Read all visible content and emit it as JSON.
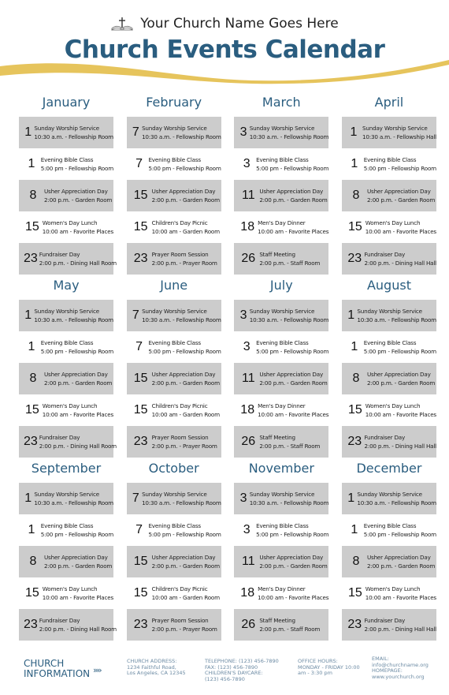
{
  "header": {
    "church_name": "Your Church Name Goes Here",
    "title": "Church Events Calendar",
    "icon": "bible-cross-icon",
    "accent_color": "#2a5d7f",
    "swoosh_color": "#e6c45c"
  },
  "months": [
    {
      "name": "January",
      "events": [
        {
          "day": "1",
          "title": "Sunday Worship Service",
          "detail": "10:30 a.m. - Fellowship Room"
        },
        {
          "day": "1",
          "title": "Evening Bible Class",
          "detail": "5:00 pm - Fellowship Room"
        },
        {
          "day": "8",
          "title": "Usher Appreciation Day",
          "detail": "2:00 p.m. - Garden Room"
        },
        {
          "day": "15",
          "title": "Women's Day Lunch",
          "detail": "10:00 am - Favorite Places"
        },
        {
          "day": "23",
          "title": "Fundraiser Day",
          "detail": "2:00 p.m. - Dining Hall Room"
        }
      ]
    },
    {
      "name": "February",
      "events": [
        {
          "day": "7",
          "title": "Sunday Worship Service",
          "detail": "10:30 a.m. - Fellowship Room"
        },
        {
          "day": "7",
          "title": "Evening Bible Class",
          "detail": "5:00 pm - Fellowship Room"
        },
        {
          "day": "15",
          "title": "Usher Appreciation Day",
          "detail": "2:00 p.m. - Garden Room"
        },
        {
          "day": "15",
          "title": "Children's Day Picnic",
          "detail": "10:00 am - Garden Room"
        },
        {
          "day": "23",
          "title": "Prayer Room Session",
          "detail": "2:00 p.m. - Prayer Room"
        }
      ]
    },
    {
      "name": "March",
      "events": [
        {
          "day": "3",
          "title": "Sunday Worship Service",
          "detail": "10:30 a.m. - Fellowship Room"
        },
        {
          "day": "3",
          "title": "Evening Bible Class",
          "detail": "5:00 pm - Fellowship Room"
        },
        {
          "day": "11",
          "title": "Usher Appreciation Day",
          "detail": "2:00 p.m. - Garden Room"
        },
        {
          "day": "18",
          "title": "Men's Day Dinner",
          "detail": "10:00 am - Favorite Places"
        },
        {
          "day": "26",
          "title": "Staff Meeting",
          "detail": "2:00 p.m. - Staff Room"
        }
      ]
    },
    {
      "name": "April",
      "events": [
        {
          "day": "1",
          "title": "Sunday Worship Service",
          "detail": "10:30 a.m. - Fellowship Hall"
        },
        {
          "day": "1",
          "title": "Evening Bible Class",
          "detail": "5:00 pm - Fellowship Room"
        },
        {
          "day": "8",
          "title": "Usher Appreciation Day",
          "detail": "2:00 p.m. - Garden Room"
        },
        {
          "day": "15",
          "title": "Women's Day Lunch",
          "detail": "10:00 am - Favorite Places"
        },
        {
          "day": "23",
          "title": "Fundraiser Day",
          "detail": "2:00 p.m. - Dining Hall Hall"
        }
      ]
    },
    {
      "name": "May",
      "events": [
        {
          "day": "1",
          "title": "Sunday Worship Service",
          "detail": "10:30 a.m. - Fellowship Room"
        },
        {
          "day": "1",
          "title": "Evening Bible Class",
          "detail": "5:00 pm - Fellowship Room"
        },
        {
          "day": "8",
          "title": "Usher Appreciation Day",
          "detail": "2:00 p.m. - Garden Room"
        },
        {
          "day": "15",
          "title": "Women's Day Lunch",
          "detail": "10:00 am - Favorite Places"
        },
        {
          "day": "23",
          "title": "Fundraiser Day",
          "detail": "2:00 p.m. - Dining Hall Room"
        }
      ]
    },
    {
      "name": "June",
      "events": [
        {
          "day": "7",
          "title": "Sunday Worship Service",
          "detail": "10:30 a.m. - Fellowship Room"
        },
        {
          "day": "7",
          "title": "Evening Bible Class",
          "detail": "5:00 pm - Fellowship Room"
        },
        {
          "day": "15",
          "title": "Usher Appreciation Day",
          "detail": "2:00 p.m. - Garden Room"
        },
        {
          "day": "15",
          "title": "Children's Day Picnic",
          "detail": "10:00 am - Garden Room"
        },
        {
          "day": "23",
          "title": "Prayer Room Session",
          "detail": "2:00 p.m. - Prayer Room"
        }
      ]
    },
    {
      "name": "July",
      "events": [
        {
          "day": "3",
          "title": "Sunday Worship Service",
          "detail": "10:30 a.m. - Fellowship Room"
        },
        {
          "day": "3",
          "title": "Evening Bible Class",
          "detail": "5:00 pm - Fellowship Room"
        },
        {
          "day": "11",
          "title": "Usher Appreciation Day",
          "detail": "2:00 p.m. - Garden Room"
        },
        {
          "day": "18",
          "title": "Men's Day Dinner",
          "detail": "10:00 am - Favorite Places"
        },
        {
          "day": "26",
          "title": "Staff Meeting",
          "detail": "2:00 p.m. - Staff Room"
        }
      ]
    },
    {
      "name": "August",
      "events": [
        {
          "day": "1",
          "title": "Sunday Worship Service",
          "detail": "10:30 a.m. - Fellowship Room"
        },
        {
          "day": "1",
          "title": "Evening Bible Class",
          "detail": "5:00 pm - Fellowship Room"
        },
        {
          "day": "8",
          "title": "Usher Appreciation Day",
          "detail": "2:00 p.m. - Garden Room"
        },
        {
          "day": "15",
          "title": "Women's Day Lunch",
          "detail": "10:00 am - Favorite Places"
        },
        {
          "day": "23",
          "title": "Fundraiser Day",
          "detail": "2:00 p.m. - Dining Hall Hall"
        }
      ]
    },
    {
      "name": "September",
      "events": [
        {
          "day": "1",
          "title": "Sunday Worship Service",
          "detail": "10:30 a.m. - Fellowship Room"
        },
        {
          "day": "1",
          "title": "Evening Bible Class",
          "detail": "5:00 pm - Fellowship Room"
        },
        {
          "day": "8",
          "title": "Usher Appreciation Day",
          "detail": "2:00 p.m. - Garden Room"
        },
        {
          "day": "15",
          "title": "Women's Day Lunch",
          "detail": "10:00 am - Favorite Places"
        },
        {
          "day": "23",
          "title": "Fundraiser Day",
          "detail": "2:00 p.m. - Dining Hall Room"
        }
      ]
    },
    {
      "name": "October",
      "events": [
        {
          "day": "7",
          "title": "Sunday Worship Service",
          "detail": "10:30 a.m. - Fellowship Room"
        },
        {
          "day": "7",
          "title": "Evening Bible Class",
          "detail": "5:00 pm - Fellowship Room"
        },
        {
          "day": "15",
          "title": "Usher Appreciation Day",
          "detail": "2:00 p.m. - Garden Room"
        },
        {
          "day": "15",
          "title": "Children's Day Picnic",
          "detail": "10:00 am - Garden Room"
        },
        {
          "day": "23",
          "title": "Prayer Room Session",
          "detail": "2:00 p.m. - Prayer Room"
        }
      ]
    },
    {
      "name": "November",
      "events": [
        {
          "day": "3",
          "title": "Sunday Worship Service",
          "detail": "10:30 a.m. - Fellowship Room"
        },
        {
          "day": "3",
          "title": "Evening Bible Class",
          "detail": "5:00 pm - Fellowship Room"
        },
        {
          "day": "11",
          "title": "Usher Appreciation Day",
          "detail": "2:00 p.m. - Garden Room"
        },
        {
          "day": "18",
          "title": "Men's Day Dinner",
          "detail": "10:00 am - Favorite Places"
        },
        {
          "day": "26",
          "title": "Staff Meeting",
          "detail": "2:00 p.m. - Staff Room"
        }
      ]
    },
    {
      "name": "December",
      "events": [
        {
          "day": "1",
          "title": "Sunday Worship Service",
          "detail": "10:30 a.m. - Fellowship Room"
        },
        {
          "day": "1",
          "title": "Evening Bible Class",
          "detail": "5:00 pm - Fellowship Room"
        },
        {
          "day": "8",
          "title": "Usher Appreciation Day",
          "detail": "2:00 p.m. - Garden Room"
        },
        {
          "day": "15",
          "title": "Women's Day Lunch",
          "detail": "10:00 am - Favorite Places"
        },
        {
          "day": "23",
          "title": "Fundraiser Day",
          "detail": "2:00 p.m. - Dining Hall Hall"
        }
      ]
    }
  ],
  "footer": {
    "heading_line1": "CHURCH",
    "heading_line2": "INFORMATION",
    "arrows": "››››",
    "address": [
      "CHURCH ADDRESS:",
      "1234 Faithful Road,",
      "Los Angeles, CA 12345"
    ],
    "phone": [
      "TELEPHONE: (123) 456-7890",
      "FAX: (123) 456-7890",
      "CHILDREN'S DAYCARE:",
      "(123) 456-7890"
    ],
    "hours": [
      "OFFICE HOURS:",
      "MONDAY - FRIDAY 10:00",
      "am - 3:30 pm"
    ],
    "web": [
      "EMAIL:",
      "info@churchname.org",
      "HOMEPAGE:",
      "www.yourchurch.org"
    ]
  }
}
